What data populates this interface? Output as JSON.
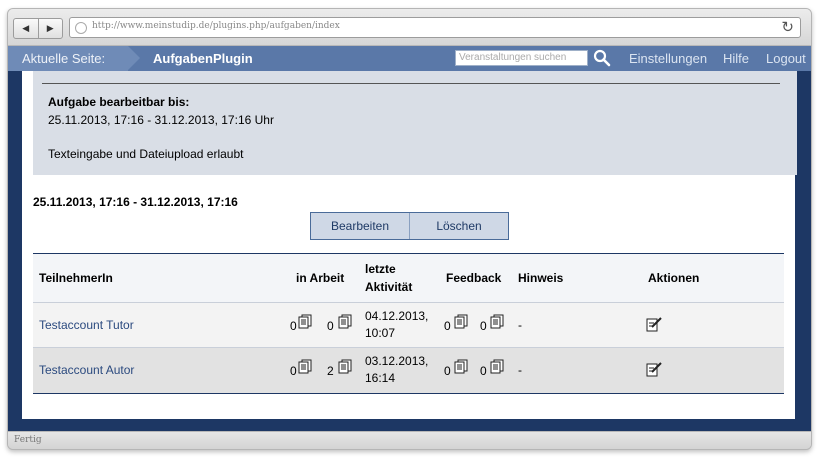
{
  "browser": {
    "back_glyph": "◀",
    "forward_glyph": "▶",
    "url": "http://www.meinstudip.de/plugins.php/aufgaben/index",
    "reload_glyph": "↻",
    "status": "Fertig"
  },
  "header": {
    "current_page_label": "Aktuelle Seite:",
    "plugin_name": "AufgabenPlugin",
    "search_placeholder": "Veranstaltungen suchen",
    "links": [
      "Einstellungen",
      "Hilfe",
      "Logout"
    ]
  },
  "info": {
    "editable_label": "Aufgabe bearbeitbar bis:",
    "editable_range": "25.11.2013, 17:16 - 31.12.2013, 17:16 Uhr",
    "note": "Texteingabe und Dateiupload erlaubt"
  },
  "range_heading": "25.11.2013, 17:16 - 31.12.2013, 17:16",
  "buttons": {
    "edit": "Bearbeiten",
    "delete": "Löschen"
  },
  "table": {
    "headers": {
      "participant": "TeilnehmerIn",
      "in_progress": "in Arbeit",
      "last_activity_1": "letzte",
      "last_activity_2": "Aktivität",
      "feedback": "Feedback",
      "hint": "Hinweis",
      "actions": "Aktionen"
    },
    "rows": [
      {
        "name": "Testaccount Tutor",
        "work_a": "0",
        "work_b": "0",
        "date": "04.12.2013,",
        "time": "10:07",
        "fb_a": "0",
        "fb_b": "0",
        "hint": "-"
      },
      {
        "name": "Testaccount Autor",
        "work_a": "0",
        "work_b": "2",
        "date": "03.12.2013,",
        "time": "16:14",
        "fb_a": "0",
        "fb_b": "0",
        "hint": "-"
      }
    ]
  },
  "icons": {
    "doc_icon": "document-icon",
    "edit_icon": "edit-icon",
    "search_icon": "magnifier-icon"
  }
}
